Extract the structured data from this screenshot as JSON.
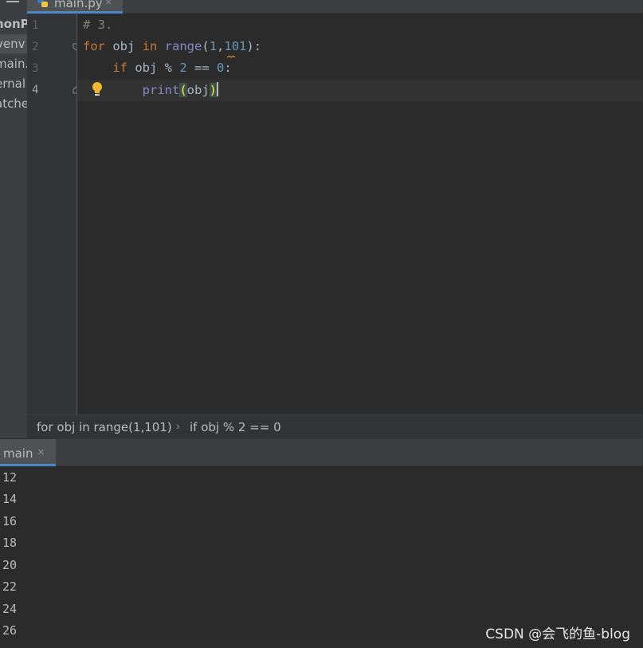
{
  "sidebar": {
    "items": [
      {
        "label": "honP"
      },
      {
        "label": "venv"
      },
      {
        "label": "main."
      },
      {
        "label": "ernal"
      },
      {
        "label": "atche"
      }
    ]
  },
  "tabs": [
    {
      "label": "main.py",
      "icon": "python-file-icon"
    }
  ],
  "editor": {
    "line_numbers": [
      "1",
      "2",
      "3",
      "4"
    ]
  },
  "breadcrumb": {
    "items": [
      "for obj in range(1,101)",
      "if obj % 2 == 0"
    ]
  },
  "run_panel": {
    "tab_label": "main",
    "output": [
      "12",
      "14",
      "16",
      "18",
      "20",
      "22",
      "24",
      "26"
    ]
  },
  "watermark": "CSDN @会飞的鱼-blog",
  "colors": {
    "keyword": "#cc7832",
    "builtin": "#8888c6",
    "number": "#6897bb",
    "comment": "#808080",
    "accent": "#4a88c7"
  }
}
